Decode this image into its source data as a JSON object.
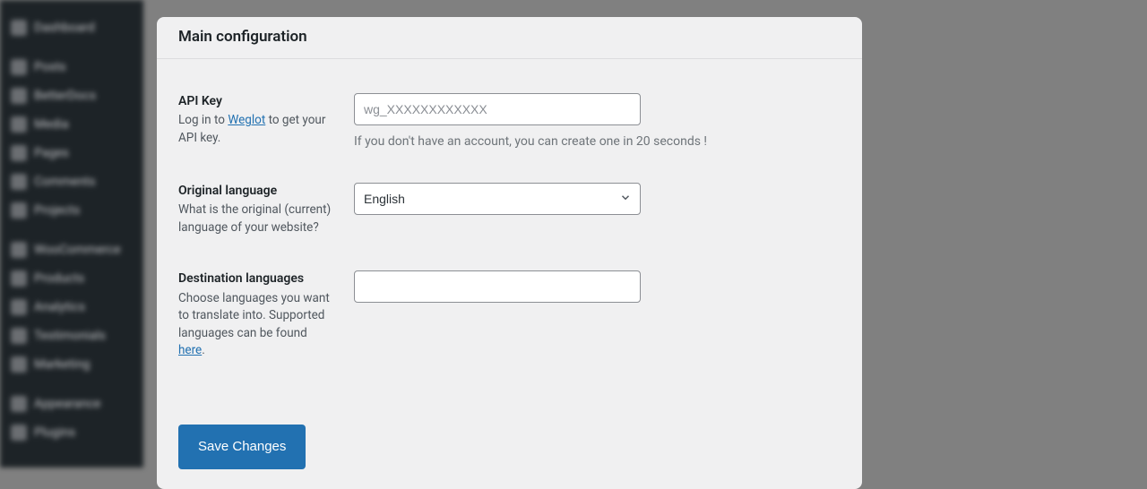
{
  "sidebar": {
    "items": [
      {
        "label": "Dashboard"
      },
      {
        "label": "Posts"
      },
      {
        "label": "BetterDocs"
      },
      {
        "label": "Media"
      },
      {
        "label": "Pages"
      },
      {
        "label": "Comments"
      },
      {
        "label": "Projects"
      },
      {
        "label": "WooCommerce"
      },
      {
        "label": "Products"
      },
      {
        "label": "Analytics"
      },
      {
        "label": "Testimonials"
      },
      {
        "label": "Marketing"
      },
      {
        "label": "Appearance"
      },
      {
        "label": "Plugins"
      }
    ]
  },
  "panel": {
    "title": "Main configuration",
    "api_key": {
      "label": "API Key",
      "desc_prefix": "Log in to ",
      "desc_link": "Weglot",
      "desc_suffix": " to get your API key.",
      "placeholder": "wg_XXXXXXXXXXXX",
      "value": "",
      "hint": "If you don't have an account, you can create one in 20 seconds !"
    },
    "original_lang": {
      "label": "Original language",
      "desc": "What is the original (current) language of your website?",
      "value": "English"
    },
    "dest_lang": {
      "label": "Destination languages",
      "desc_prefix": "Choose languages you want to translate into. Supported languages can be found ",
      "desc_link": "here",
      "desc_suffix": "."
    },
    "save_label": "Save Changes"
  }
}
